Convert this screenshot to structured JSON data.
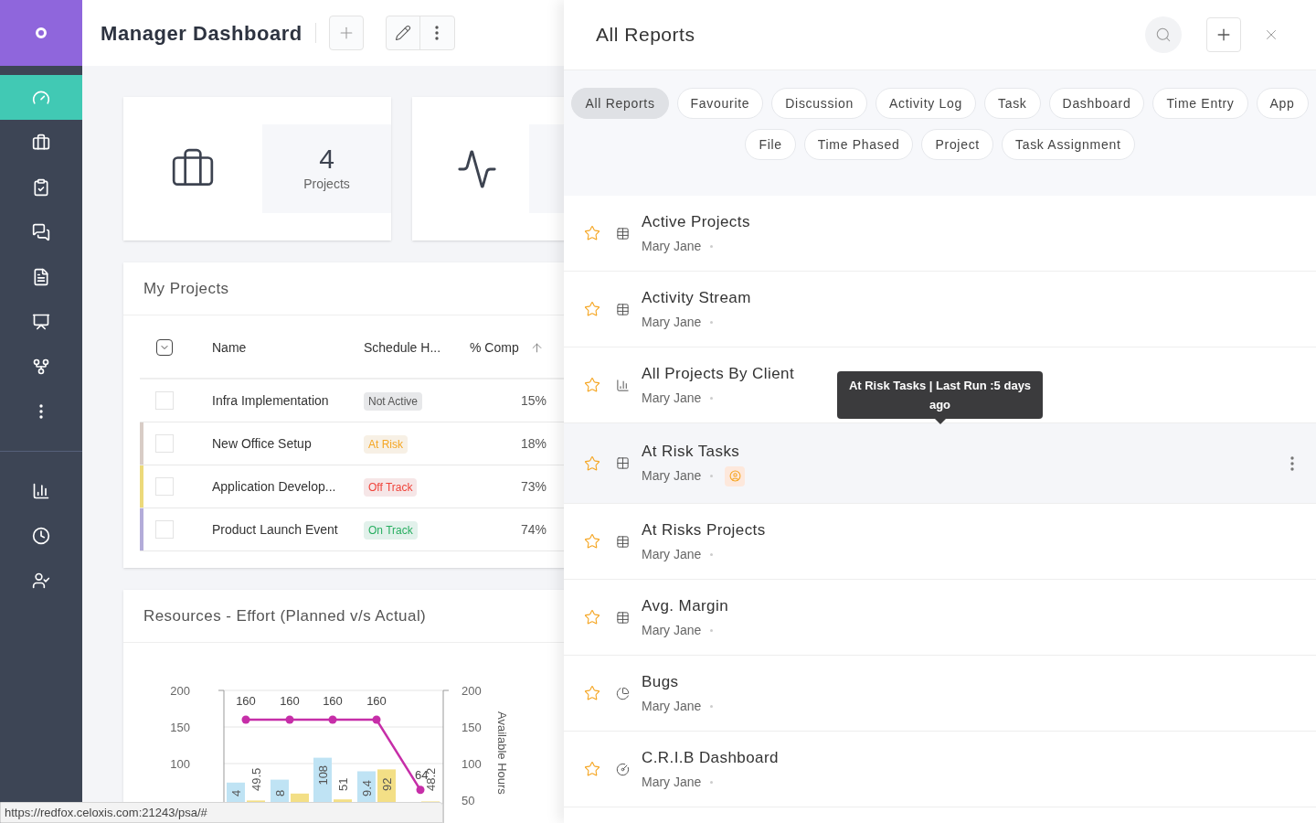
{
  "sidebar": {
    "items": [
      {
        "selected": false
      },
      {
        "selected": true
      },
      {
        "selected": false
      },
      {
        "selected": false
      },
      {
        "selected": false
      },
      {
        "selected": false
      },
      {
        "selected": false
      },
      {
        "selected": false
      },
      {
        "selected": false
      }
    ],
    "bottom_items": [
      {
        "selected": false
      },
      {
        "selected": false
      },
      {
        "selected": false
      }
    ]
  },
  "header": {
    "title": "Manager Dashboard"
  },
  "stat_card": {
    "value": "4",
    "label": "Projects"
  },
  "my_projects": {
    "title": "My Projects",
    "columns": [
      "Name",
      "Schedule H...",
      "% Comp"
    ],
    "rows": [
      {
        "name": "Infra Implementation",
        "status": {
          "label": "Not Active",
          "color": "#555555"
        },
        "percent": "15%",
        "checked": false
      },
      {
        "name": "New Office Setup",
        "status": {
          "label": "At Risk",
          "color": "#f5a623"
        },
        "percent": "18%",
        "checked": false,
        "color": "#d8ccc6"
      },
      {
        "name": "Application Develop...",
        "status": {
          "label": "Off Track",
          "color": "#f0433a"
        },
        "percent": "73%",
        "checked": false,
        "color": "#ecd97a"
      },
      {
        "name": "Product Launch Event",
        "status": {
          "label": "On Track",
          "color": "#27ae60"
        },
        "percent": "74%",
        "checked": false,
        "color": "#b3acd9"
      }
    ]
  },
  "effort_chart": {
    "title": "Resources - Effort (Planned v/s Actual)",
    "cut_labels": [
      "4",
      "8",
      "9.4"
    ],
    "chart_data": {
      "type": "bar",
      "y2label": "Available Hours",
      "ylim": [
        0,
        200
      ],
      "yticks": [
        100,
        150,
        200
      ],
      "y2lim": [
        0,
        200
      ],
      "y2ticks": [
        50,
        100,
        150,
        200
      ],
      "stacked": false,
      "series": [
        {
          "type": "bar",
          "color": "#bfe3f4",
          "values": [
            74,
            78,
            108,
            89.4,
            null
          ],
          "value_labels": [
            null,
            null,
            "108",
            null,
            null
          ]
        },
        {
          "type": "bar",
          "color": "#f3df86",
          "values": [
            49.5,
            59,
            51,
            92,
            48.2
          ],
          "value_labels": [
            "49.5",
            null,
            "51",
            "92",
            "48.2"
          ]
        },
        {
          "type": "line",
          "color": "#c62ea8",
          "marker": "circle",
          "values": [
            160,
            160,
            160,
            160,
            64
          ],
          "value_labels": [
            "160",
            "160",
            "160",
            "160",
            "64"
          ]
        }
      ]
    }
  },
  "status_bar": {
    "url": "https://redfox.celoxis.com:21243/psa/#"
  },
  "reports_panel": {
    "title": "All Reports",
    "filters": [
      {
        "label": "All Reports",
        "selected": true
      },
      {
        "label": "Favourite",
        "selected": false
      },
      {
        "label": "Discussion",
        "selected": false
      },
      {
        "label": "Activity Log",
        "selected": false
      },
      {
        "label": "Task",
        "selected": false
      },
      {
        "label": "Dashboard",
        "selected": false
      },
      {
        "label": "Time Entry",
        "selected": false
      },
      {
        "label": "App",
        "selected": false
      },
      {
        "label": "File",
        "selected": false
      },
      {
        "label": "Time Phased",
        "selected": false
      },
      {
        "label": "Project",
        "selected": false
      },
      {
        "label": "Task Assignment",
        "selected": false
      }
    ],
    "reports": [
      {
        "title": "Active Projects",
        "author": "Mary Jane",
        "kind": "table",
        "highlighted": false,
        "shared": false
      },
      {
        "title": "Activity Stream",
        "author": "Mary Jane",
        "kind": "table",
        "highlighted": false,
        "shared": false
      },
      {
        "title": "All Projects By Client",
        "author": "Mary Jane",
        "kind": "bar",
        "highlighted": false,
        "shared": false
      },
      {
        "title": "At Risk Tasks",
        "author": "Mary Jane",
        "kind": "grid",
        "highlighted": true,
        "shared": true
      },
      {
        "title": "At Risks Projects",
        "author": "Mary Jane",
        "kind": "table",
        "highlighted": false,
        "shared": false
      },
      {
        "title": "Avg. Margin",
        "author": "Mary Jane",
        "kind": "table",
        "highlighted": false,
        "shared": false
      },
      {
        "title": "Bugs",
        "author": "Mary Jane",
        "kind": "pie",
        "highlighted": false,
        "shared": false
      },
      {
        "title": "C.R.I.B Dashboard",
        "author": "Mary Jane",
        "kind": "gauge",
        "highlighted": false,
        "shared": false
      }
    ],
    "tooltip": {
      "text": "At Risk Tasks | Last Run :5 days ago"
    }
  }
}
